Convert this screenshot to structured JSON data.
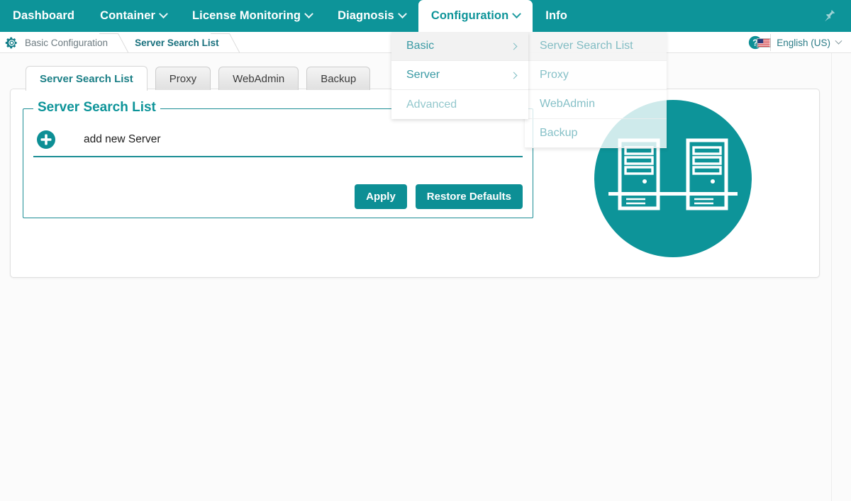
{
  "menubar": {
    "items": [
      {
        "label": "Dashboard",
        "has_caret": false,
        "active": false
      },
      {
        "label": "Container",
        "has_caret": true,
        "active": false
      },
      {
        "label": "License Monitoring",
        "has_caret": true,
        "active": false
      },
      {
        "label": "Diagnosis",
        "has_caret": true,
        "active": false
      },
      {
        "label": "Configuration",
        "has_caret": true,
        "active": true
      },
      {
        "label": "Info",
        "has_caret": false,
        "active": false
      }
    ],
    "pin_icon": "pushpin-icon",
    "background_color": "#0d9499"
  },
  "breadcrumb": {
    "gear_icon": "gear-icon",
    "items": [
      {
        "label": "Basic Configuration",
        "current": false
      },
      {
        "label": "Server Search List",
        "current": true
      }
    ]
  },
  "toolbar": {
    "help_icon": "help-circle-icon",
    "language": {
      "flag_icon": "us-flag-icon",
      "label": "English (US)",
      "caret_icon": "chevron-down-icon"
    }
  },
  "dropdown": {
    "primary": {
      "items": [
        {
          "label": "Basic",
          "has_submenu": true,
          "state": "highlighted"
        },
        {
          "label": "Server",
          "has_submenu": true,
          "state": "normal"
        },
        {
          "label": "Advanced",
          "has_submenu": false,
          "state": "fading"
        }
      ]
    },
    "submenu": {
      "items": [
        {
          "label": "Server Search List",
          "state": "highlighted"
        },
        {
          "label": "Proxy",
          "state": "normal"
        },
        {
          "label": "WebAdmin",
          "state": "normal"
        },
        {
          "label": "Backup",
          "state": "normal"
        }
      ]
    }
  },
  "tabs": [
    {
      "label": "Server Search List",
      "active": true
    },
    {
      "label": "Proxy",
      "active": false
    },
    {
      "label": "WebAdmin",
      "active": false
    },
    {
      "label": "Backup",
      "active": false
    }
  ],
  "panel": {
    "legend": "Server Search List",
    "add_row": {
      "plus_icon": "plus-circle-icon",
      "label": "add new Server"
    },
    "buttons": {
      "apply": "Apply",
      "restore_defaults": "Restore Defaults"
    }
  },
  "illustration": {
    "name": "two-servers-network-icon",
    "circle_color": "#0d9499"
  },
  "colors": {
    "accent": "#0d9499",
    "accent_dark": "#176f7c",
    "page_background": "#fbfbfb",
    "card_background": "#ffffff"
  }
}
